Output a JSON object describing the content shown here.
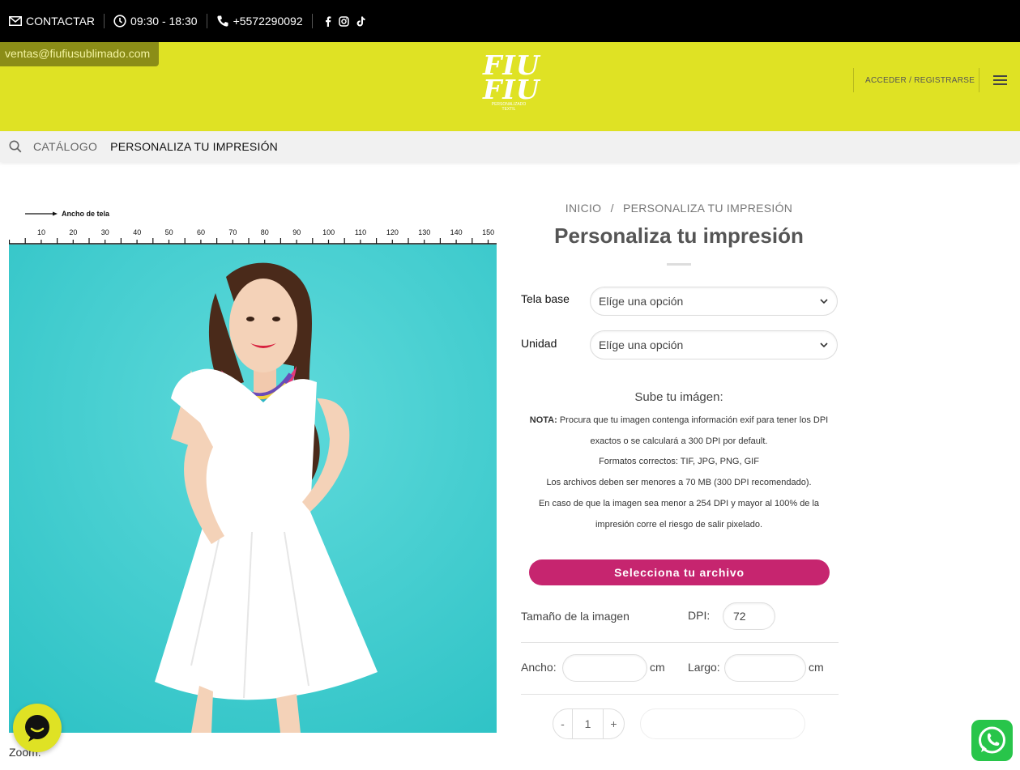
{
  "topbar": {
    "contact": "CONTACTAR",
    "hours": "09:30 - 18:30",
    "phone": "+5572290092",
    "social_icons": [
      "facebook-icon",
      "instagram-icon",
      "tiktok-icon"
    ]
  },
  "header": {
    "email": "ventas@fiufiusublimado.com",
    "logo_big": "FIU\nFIU",
    "logo_small": "PERSONALIZADO\nTEXTIL",
    "login": "ACCEDER / REGISTRARSE",
    "bg_color": "#dfe224"
  },
  "nav": {
    "catalog": "CATÁLOGO",
    "current": "PERSONALIZA TU IMPRESIÓN"
  },
  "ruler": {
    "label": "Ancho de tela",
    "ticks": [
      "10",
      "20",
      "30",
      "40",
      "50",
      "60",
      "70",
      "80",
      "90",
      "100",
      "110",
      "120",
      "130",
      "140",
      "150"
    ]
  },
  "zoom_label": "Zoom:",
  "breadcrumb": {
    "home": "INICIO",
    "separator": "/",
    "current": "PERSONALIZA TU IMPRESIÓN"
  },
  "product": {
    "title": "Personaliza tu impresión",
    "tela_label": "Tela base",
    "tela_value": "Elíge una opción",
    "unidad_label": "Unidad",
    "unidad_value": "Elíge una opción"
  },
  "upload": {
    "heading": "Sube tu imágen:",
    "note_prefix": "NOTA:",
    "note_line1": " Procura que tu imagen contenga información exif para tener los DPI",
    "note_line2": "exactos o se calculará a 300 DPI por default.",
    "formats": "Formatos correctos: TIF, JPG, PNG, GIF",
    "size_limit": "Los archivos deben ser menores a 70 MB (300 DPI recomendado).",
    "warning1": "En caso de que la imagen sea menor a 254 DPI y mayor al 100% de la",
    "warning2": "impresión corre el riesgo de salir pixelado.",
    "button": "Selecciona tu archivo",
    "button_color": "#c6256f"
  },
  "dimensions": {
    "size_label": "Tamaño de la imagen",
    "dpi_label": "DPI:",
    "dpi_value": "72",
    "ancho_label": "Ancho:",
    "largo_label": "Largo:",
    "unit": "cm"
  },
  "quantity": {
    "minus": "-",
    "value": "1",
    "plus": "+"
  }
}
